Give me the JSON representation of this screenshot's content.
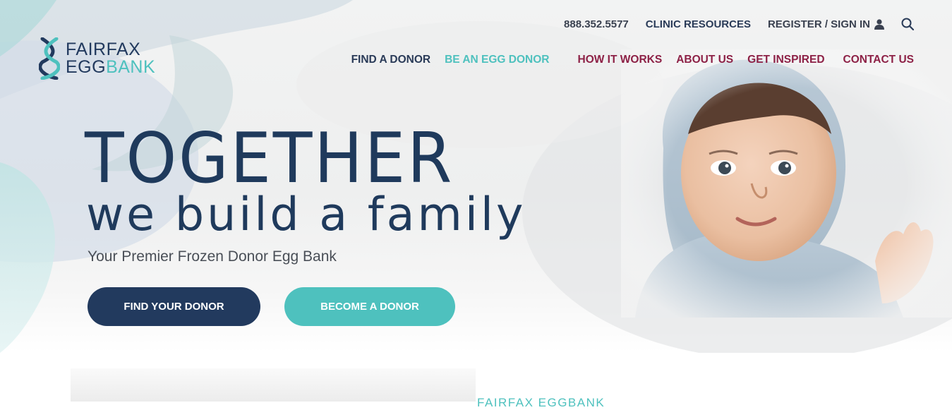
{
  "brand": {
    "logo_line1": "FAIRFAX",
    "logo_egg": "EGG",
    "logo_bank": "BANK"
  },
  "utility_nav": {
    "phone": "888.352.5577",
    "clinic_resources": "CLINIC RESOURCES",
    "register_sign_in": "REGISTER / SIGN IN"
  },
  "main_nav": {
    "items": [
      "FIND A DONOR",
      "BE AN EGG DONOR",
      "HOW IT WORKS",
      "ABOUT US",
      "GET INSPIRED",
      "CONTACT US"
    ]
  },
  "hero": {
    "headline_1": "TOGETHER",
    "headline_2": "we build a family",
    "subtitle": "Your Premier Frozen Donor Egg Bank",
    "primary_cta": "FIND YOUR DONOR",
    "secondary_cta": "BECOME A DONOR"
  },
  "section": {
    "label": "FAIRFAX EGGBANK"
  },
  "icons": {
    "user": "user-icon",
    "search": "search-icon",
    "logo": "dna-helix-logo-icon"
  },
  "colors": {
    "navy": "#223a5e",
    "teal": "#4ec1be",
    "burgundy": "#8d2146",
    "text_gray": "#4a4f57"
  }
}
